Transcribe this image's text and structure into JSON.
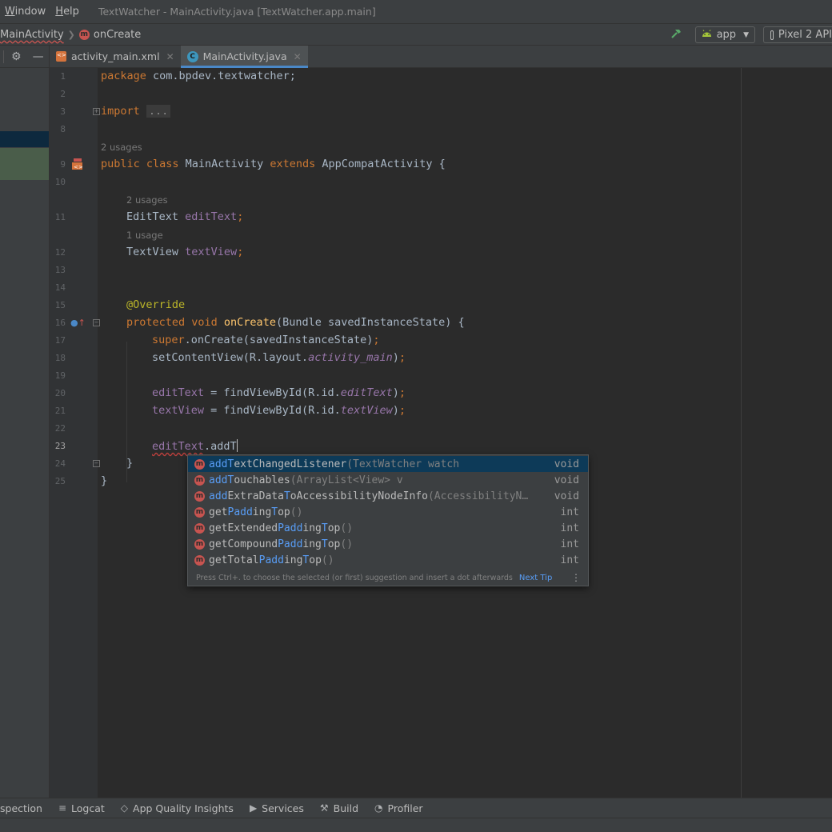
{
  "menubar": {
    "items": [
      {
        "pre": "",
        "u": "W",
        "rest": "indow"
      },
      {
        "pre": "",
        "u": "H",
        "rest": "elp"
      }
    ],
    "window_title": "TextWatcher - MainActivity.java [TextWatcher.app.main]"
  },
  "navbar": {
    "breadcrumb_class": "MainActivity",
    "breadcrumb_method": "onCreate",
    "method_icon_letter": "m",
    "run_config": "app",
    "device": "Pixel 2 API"
  },
  "tabs": [
    {
      "label": "activity_main.xml",
      "icon": "xml-file-icon"
    },
    {
      "label": "MainActivity.java",
      "icon": "java-class-icon",
      "active": true
    }
  ],
  "tab_icon_letter": "C",
  "editor": {
    "hints": {
      "class_usages": "2 usages",
      "edittext_usages": "2 usages",
      "textview_usages": "1 usage"
    },
    "lines": {
      "l1": {
        "num": "1",
        "kw": "package",
        "rest": " com.bpdev.textwatcher;"
      },
      "l2": {
        "num": "2"
      },
      "l3": {
        "num": "3",
        "kw": "import",
        "fold": "..."
      },
      "l8": {
        "num": "8"
      },
      "l9": {
        "num": "9",
        "kw1": "public class",
        "name": " MainActivity ",
        "kw2": "extends",
        "rest": " AppCompatActivity {"
      },
      "l10": {
        "num": "10"
      },
      "l11": {
        "num": "11",
        "type": "EditText ",
        "field": "editText",
        "semi": ";"
      },
      "l12": {
        "num": "12",
        "type": "TextView ",
        "field": "textView",
        "semi": ";"
      },
      "l13": {
        "num": "13"
      },
      "l14": {
        "num": "14"
      },
      "l15": {
        "num": "15",
        "ann": "@Override"
      },
      "l16": {
        "num": "16",
        "kw": "protected void ",
        "fn": "onCreate",
        "rest": "(Bundle savedInstanceState) {"
      },
      "l17": {
        "num": "17",
        "kw": "super",
        "rest": ".onCreate(savedInstanceState)",
        "semi": ";"
      },
      "l18": {
        "num": "18",
        "pre": "setContentView(R.layout.",
        "fld": "activity_main",
        "post": ")",
        "semi": ";"
      },
      "l19": {
        "num": "19"
      },
      "l20": {
        "num": "20",
        "field": "editText",
        "pre": " = findViewById(R.id.",
        "fld": "editText",
        "post": ")",
        "semi": ";"
      },
      "l21": {
        "num": "21",
        "field": "textView",
        "pre": " = findViewById(R.id.",
        "fld": "textView",
        "post": ")",
        "semi": ";"
      },
      "l22": {
        "num": "22"
      },
      "l23": {
        "num": "23",
        "field": "editText",
        "rest": ".addT"
      },
      "l24": {
        "num": "24",
        "rest": "}"
      },
      "l25": {
        "num": "25",
        "rest": "}"
      }
    }
  },
  "completion": {
    "items": [
      {
        "hl": "add",
        "mid1": "T",
        "name": "extChangedListener",
        "sig": "(TextWatcher watcher)",
        "ret": "void"
      },
      {
        "hl": "add",
        "mid1": "T",
        "name": "ouchables",
        "sig": "(ArrayList<View> views)",
        "ret": "void"
      },
      {
        "hl": "add",
        "mid1": "",
        "name": "ExtraData",
        "mid2": "T",
        "name2": "oAccessibilityNodeInfo",
        "sig": "(AccessibilityN…",
        "ret": "void"
      },
      {
        "a": "get",
        "b": "P",
        "c": "add",
        "d": "ing",
        "e": "T",
        "f": "op",
        "sig": "()",
        "ret": "int"
      },
      {
        "a": "getExtended",
        "b": "P",
        "c": "add",
        "d": "ing",
        "e": "T",
        "f": "op",
        "sig": "()",
        "ret": "int"
      },
      {
        "a": "getCompound",
        "b": "P",
        "c": "add",
        "d": "ing",
        "e": "T",
        "f": "op",
        "sig": "()",
        "ret": "int"
      },
      {
        "a": "getTotal",
        "b": "P",
        "c": "add",
        "d": "ing",
        "e": "T",
        "f": "op",
        "sig": "()",
        "ret": "int"
      }
    ],
    "footer": "Press Ctrl+. to choose the selected (or first) suggestion and insert a dot afterwards",
    "next_tip": "Next Tip"
  },
  "bottombar": {
    "inspection": "spection",
    "logcat": "Logcat",
    "quality": "App Quality Insights",
    "services": "Services",
    "build": "Build",
    "profiler": "Profiler"
  },
  "colors": {
    "keyword": "#cc7832",
    "field": "#9876aa",
    "method": "#ffc66d",
    "annotation": "#bbb529",
    "selection": "#0d3a58",
    "match_highlight": "#589df6"
  }
}
